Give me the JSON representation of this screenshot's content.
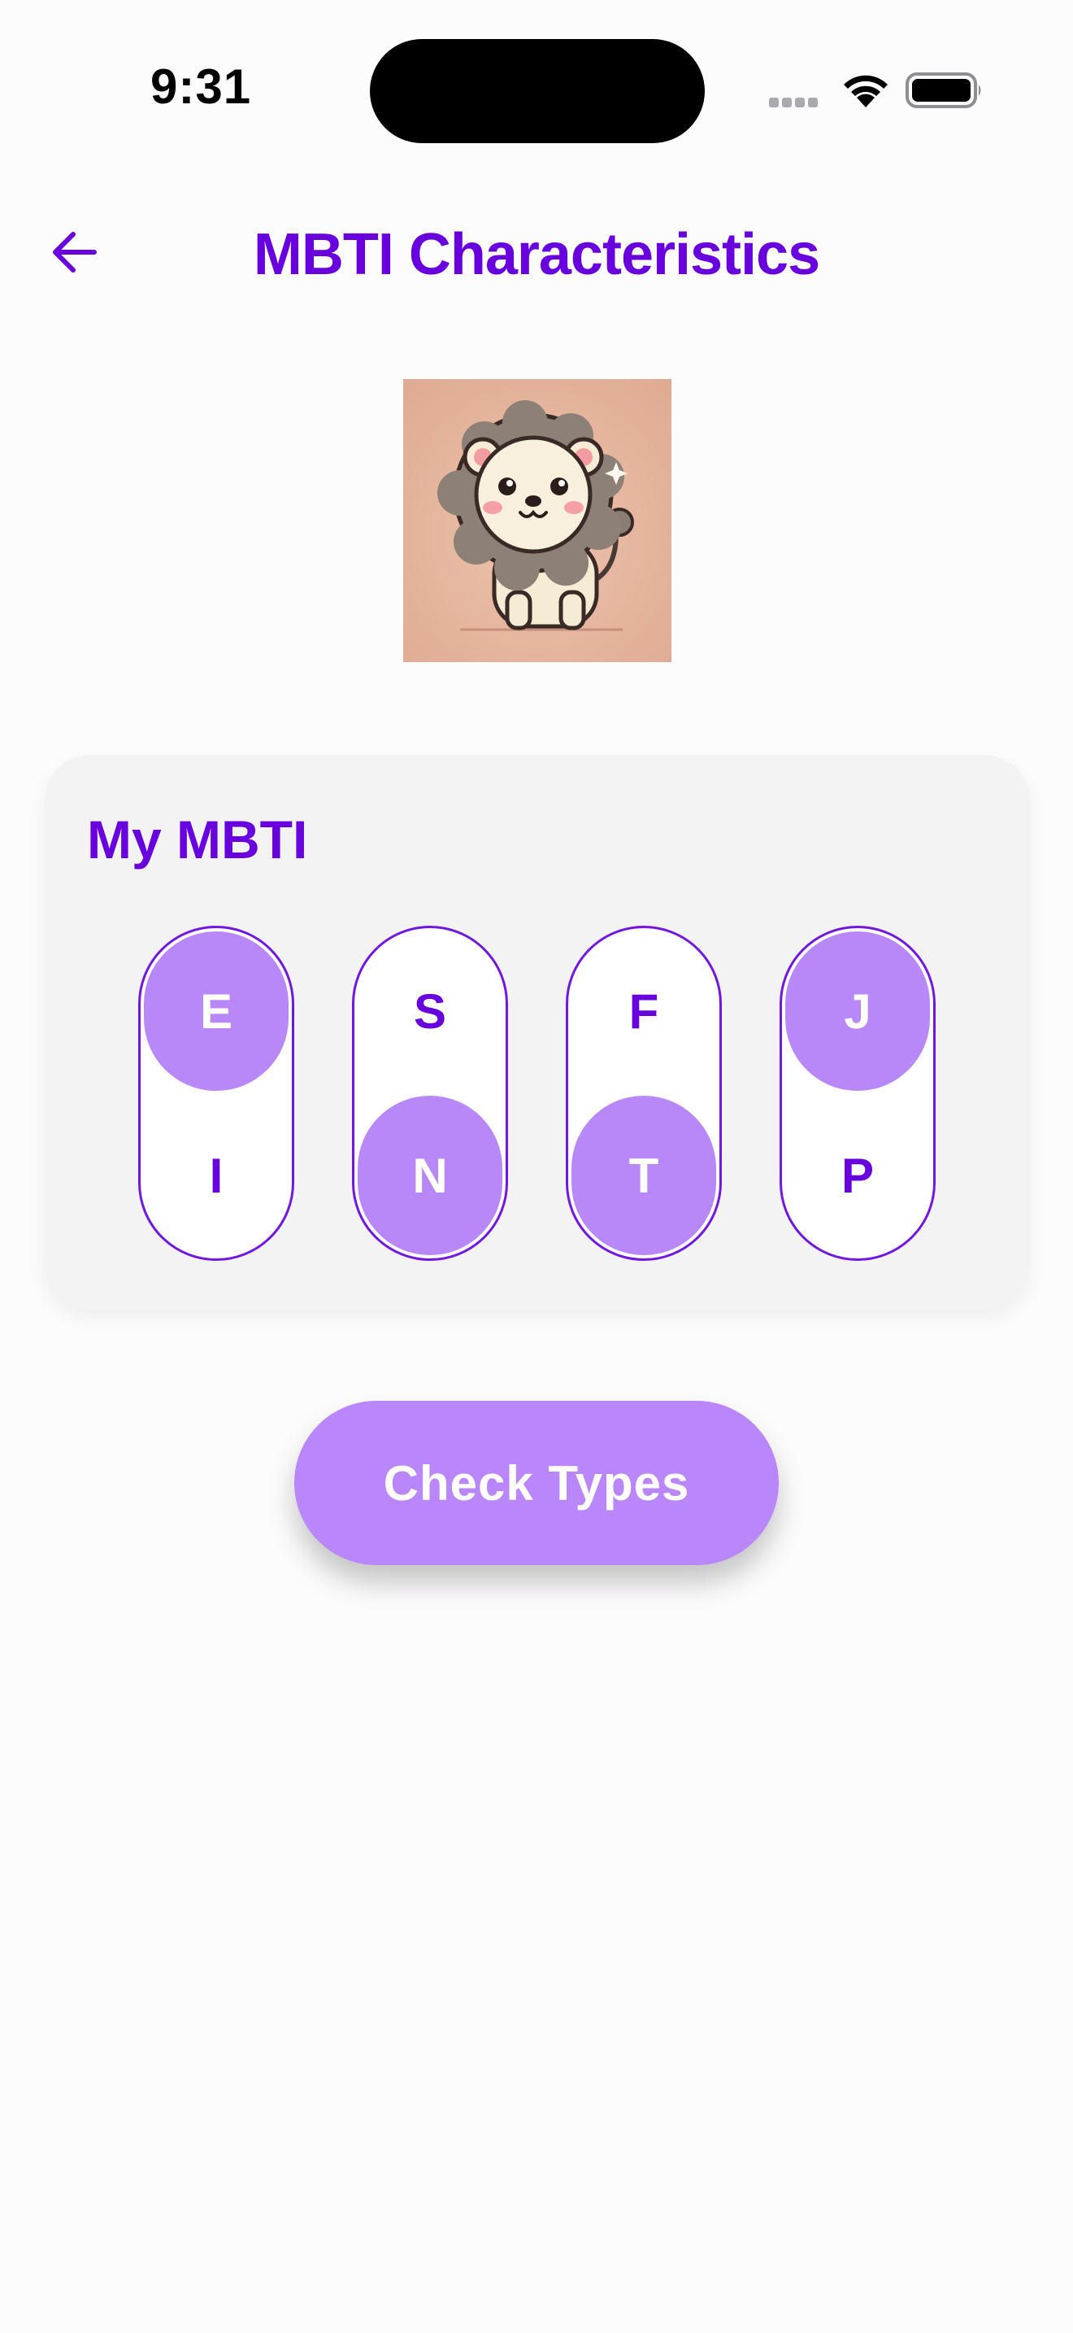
{
  "status_bar": {
    "time": "9:31"
  },
  "header": {
    "title": "MBTI Characteristics",
    "back_icon": "arrow-left-icon"
  },
  "avatar": {
    "description_icon": "lion-mascot-icon"
  },
  "mbti_card": {
    "title": "My MBTI",
    "pairs": [
      {
        "top": "E",
        "bottom": "I",
        "selected": "top"
      },
      {
        "top": "S",
        "bottom": "N",
        "selected": "bottom"
      },
      {
        "top": "F",
        "bottom": "T",
        "selected": "bottom"
      },
      {
        "top": "J",
        "bottom": "P",
        "selected": "top"
      }
    ]
  },
  "actions": {
    "check_types_label": "Check Types"
  },
  "colors": {
    "accent": "#6800dd",
    "selected": "#b988f8",
    "card_bg": "#f3f3f4"
  }
}
